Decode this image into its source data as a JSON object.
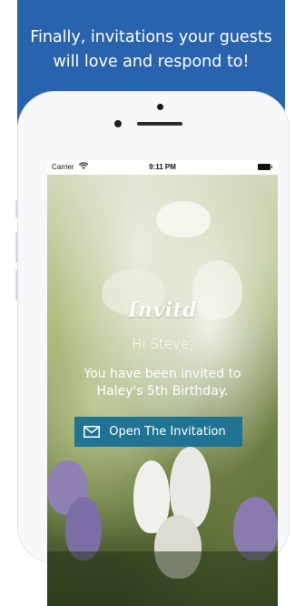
{
  "promo": {
    "headline": "Finally, invitations your guests\nwill love and respond to!"
  },
  "status_bar": {
    "carrier": "Carrier",
    "time": "9:11 PM",
    "wifi_icon": "wifi-icon",
    "battery_icon": "battery-icon"
  },
  "invite": {
    "logo": "Invitd",
    "greeting": "Hi Steve,",
    "message": "You have been invited to\nHaley's 5th Birthday.",
    "open_button_label": "Open The Invitation",
    "open_button_icon": "envelope-icon"
  },
  "colors": {
    "promo_background": "#2a63ad",
    "button_background": "#1f7493",
    "text": "#ffffff"
  }
}
